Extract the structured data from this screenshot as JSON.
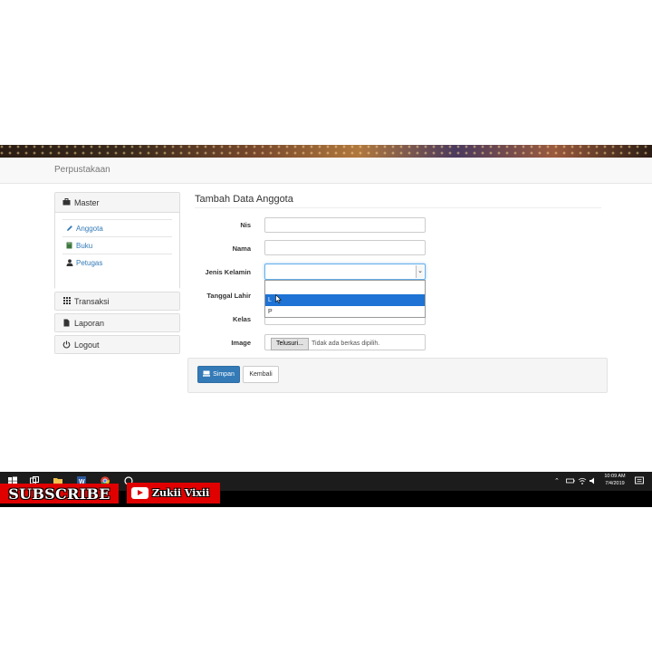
{
  "navbar": {
    "brand": "Perpustakaan"
  },
  "sidebar": {
    "master": {
      "label": "Master",
      "items": [
        {
          "label": "Anggota",
          "icon": "pencil-icon"
        },
        {
          "label": "Buku",
          "icon": "book-icon"
        },
        {
          "label": "Petugas",
          "icon": "user-icon"
        }
      ]
    },
    "transaksi": {
      "label": "Transaksi",
      "icon": "grid-icon"
    },
    "laporan": {
      "label": "Laporan",
      "icon": "file-icon"
    },
    "logout": {
      "label": "Logout",
      "icon": "power-icon"
    }
  },
  "form": {
    "title": "Tambah Data Anggota",
    "labels": {
      "nis": "Nis",
      "nama": "Nama",
      "jenis_kelamin": "Jenis Kelamin",
      "tanggal_lahir": "Tanggal Lahir",
      "kelas": "Kelas",
      "image": "Image"
    },
    "jenis_kelamin_options": [
      "",
      "L",
      "P"
    ],
    "highlighted_option": "L",
    "file_button": "Telusuri...",
    "file_status": "Tidak ada berkas dipilih.",
    "submit_label": "Simpan",
    "back_label": "Kembali"
  },
  "taskbar": {
    "time": "10:09 AM",
    "date": "7/4/2019"
  },
  "overlay": {
    "subscribe": "SUBSCRIBE",
    "channel": "Zukii Vixii"
  },
  "colors": {
    "primary": "#337ab7",
    "select_highlight": "#1e73d4",
    "banner_red": "#e00000"
  }
}
